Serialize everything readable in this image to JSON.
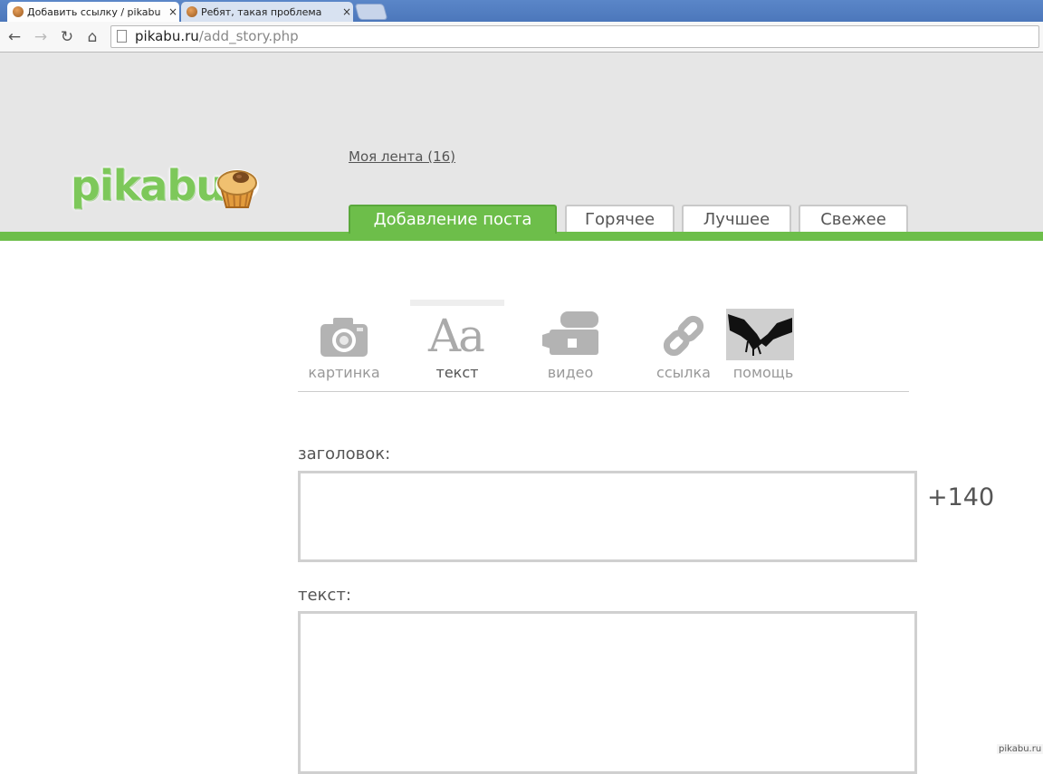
{
  "browser": {
    "tabs": [
      {
        "title": "Добавить ссылку / pikabu",
        "close": "×"
      },
      {
        "title": "Ребят, такая проблема",
        "close": "×"
      }
    ],
    "url_host": "pikabu.ru",
    "url_path": "/add_story.php"
  },
  "site": {
    "logo": "pikabu",
    "my_feed": "Моя лента (16)",
    "nav_tabs": [
      "Добавление поста",
      "Горячее",
      "Лучшее",
      "Свежее"
    ],
    "active_tab": "Добавление поста"
  },
  "post_types": [
    {
      "label": "картинка",
      "icon": "camera-icon"
    },
    {
      "label": "текст",
      "icon": "text-icon",
      "selected": true
    },
    {
      "label": "видео",
      "icon": "video-camera-icon"
    },
    {
      "label": "ссылка",
      "icon": "link-icon"
    },
    {
      "label": "помощь",
      "icon": "help-image"
    }
  ],
  "form": {
    "title_label": "заголовок:",
    "title_value": "",
    "counter": "+140",
    "text_label": "текст:",
    "text_value": ""
  },
  "watermark": "pikabu.ru"
}
